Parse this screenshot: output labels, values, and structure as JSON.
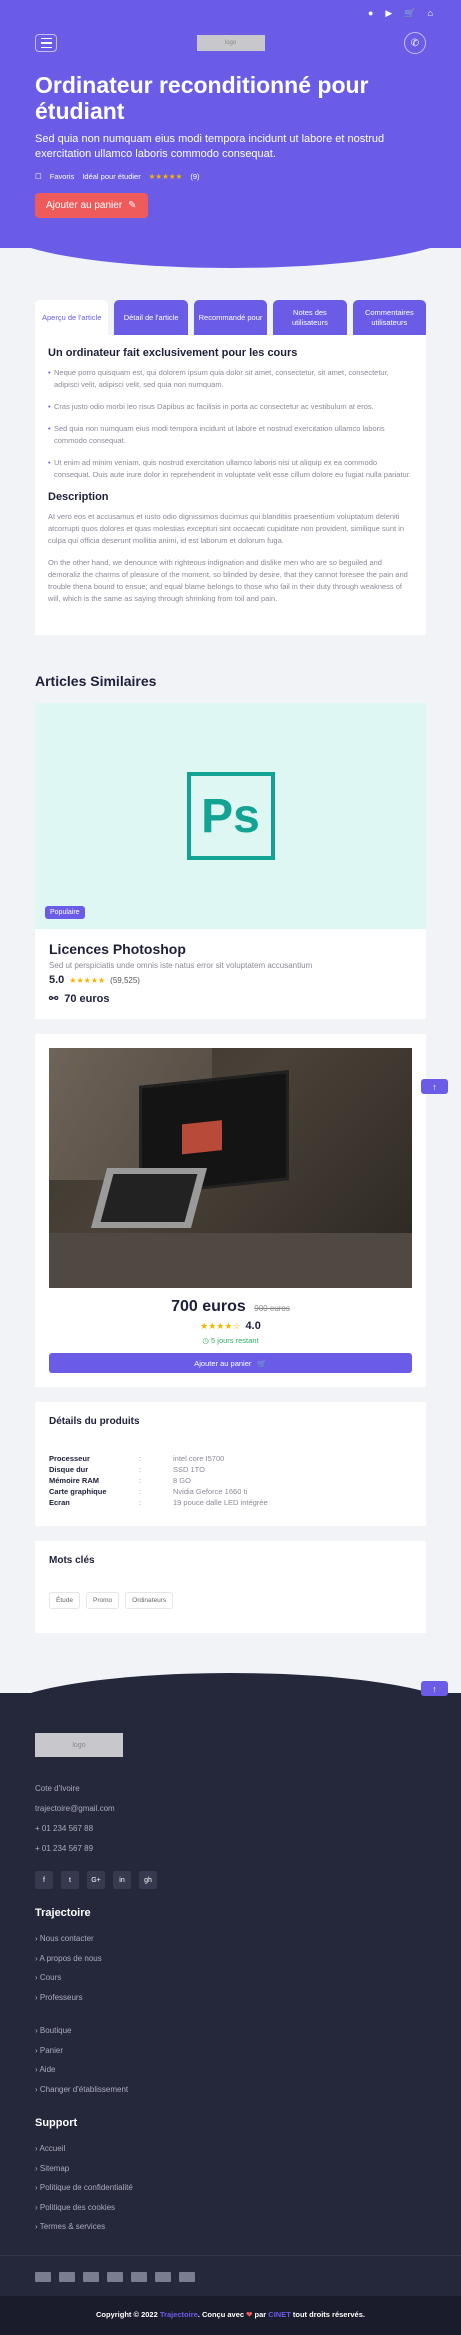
{
  "topbar": {
    "icons": [
      "user-icon",
      "megaphone-icon",
      "cart-icon",
      "home-icon"
    ]
  },
  "nav": {
    "logo": "logo"
  },
  "hero": {
    "title": "Ordinateur reconditionné pour étudiant",
    "subtitle": "Sed quia non numquam eius modi tempora incidunt ut labore et nostrud exercitation ullamco laboris commodo consequat.",
    "favoris": "Favoris",
    "ideal": "Idéal pour étudier",
    "stars": "★★★★★",
    "reviews": "(9)",
    "cart_button": "Ajouter au panier"
  },
  "tabs": [
    "Aperçu de l'article",
    "Détail de l'article",
    "Recommandé pour",
    "Notes des utilisateurs",
    "Commentaires utilisateurs"
  ],
  "overview": {
    "heading": "Un ordinateur fait exclusivement pour les cours",
    "bullets": [
      "Neque porro quisquam est, qui dolorem ipsum quia dolor sit amet, consectetur, sit amet, consectetur, adipisci velit, adipisci velit, sed quia non numquam.",
      "Cras justo odio morbi leo risus Dapibus ac facilisis in porta ac consectetur ac vestibulum at eros.",
      "Sed quia non numquam eius modi tempora incidunt ut labore et nostrud exercitation ullamco laboris commodo consequat.",
      "Ut enim ad minim veniam, quis nostrud exercitation ullamco laboris nisi ut aliquip ex ea commodo consequat. Duis aute irure dolor in reprehenderit in voluptate velit esse cillum dolore eu fugiat nulla pariatur."
    ],
    "description_title": "Description",
    "paragraphs": [
      "At vero eos et accusamus et iusto odio dignissimos ducimus qui blanditiis praesentium voluptatum deleniti atcorrupti quos dolores et quas molestias excepturi sint occaecati cupiditate non provident, similique sunt in culpa qui officia deserunt mollitia animi, id est laborum et dolorum fuga.",
      "On the other hand, we denounce with righteous indignation and dislike men who are so beguiled and demoraliz the charms of pleasure of the moment, so blinded by desire, that they cannot foresee the pain and trouble thena bound to ensue; and equal blame belongs to those who fail in their duty through weakness of will, which is the same as saying through shrinking from toil and pain."
    ]
  },
  "similar": {
    "title": "Articles Similaires",
    "card": {
      "badge": "Populaire",
      "name": "Licences Photoshop",
      "desc": "Sed ut perspiciatis unde omnis iste natus error sit voluptatem accusantium",
      "rating": "5.0",
      "stars": "★★★★★",
      "reviews": "(59,525)",
      "price": "70 euros",
      "logo_text": "Ps"
    }
  },
  "product": {
    "price": "700 euros",
    "old_price": "900 euros",
    "stars": "★★★★☆",
    "rating": "4.0",
    "days_left": "5 jours restant",
    "buy_button": "Ajouter au panier"
  },
  "details": {
    "title": "Détails du produits",
    "rows": [
      {
        "k": "Processeur",
        "c": ":",
        "v": "intel core I5700"
      },
      {
        "k": "Disque dur",
        "c": ":",
        "v": "SSD 1TO"
      },
      {
        "k": "Mémoire RAM",
        "c": ":",
        "v": "8 GO"
      },
      {
        "k": "Carte graphique",
        "c": ":",
        "v": "Nvidia Geforce 1660 ti"
      },
      {
        "k": "Ecran",
        "c": ":",
        "v": "19 pouce dalle LED intégrée"
      }
    ]
  },
  "tags": {
    "title": "Mots clés",
    "items": [
      "Étude",
      "Promo",
      "Ordinateurs"
    ]
  },
  "footer": {
    "logo": "logo",
    "location": "Cote d'Ivoire",
    "email": "trajectoire@gmail.com",
    "phone1": "+ 01 234 567 88",
    "phone2": "+ 01 234 567 89",
    "socials": [
      "f",
      "t",
      "G+",
      "in",
      "gh"
    ],
    "section1": "Trajectoire",
    "links1": [
      "Nous contacter",
      "A propos de nous",
      "Cours",
      "Professeurs"
    ],
    "links2": [
      "Boutique",
      "Panier",
      "Aide",
      "Changer d'établissement"
    ],
    "section2": "Support",
    "links3": [
      "Accueil",
      "Sitemap",
      "Politique de confidentialité",
      "Politique des cookies",
      "Termes & services"
    ],
    "copy_pre": "Copyright © 2022 ",
    "copy_brand": "Trajectoire",
    "copy_mid": ". Conçu avec ",
    "copy_heart": "❤",
    "copy_by": " par ",
    "copy_author": "CINET",
    "copy_post": " tout droits réservés."
  }
}
